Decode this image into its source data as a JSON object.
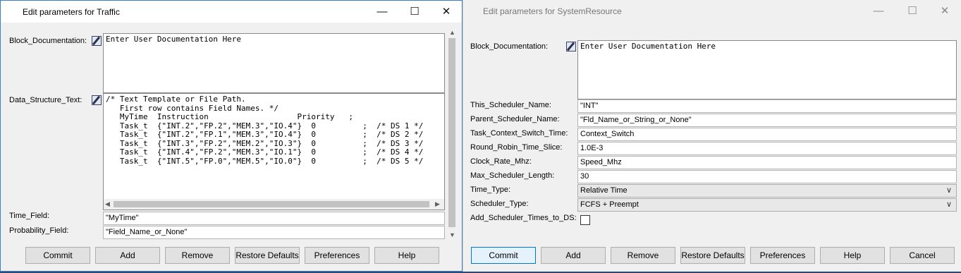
{
  "traffic": {
    "title": "Edit parameters for Traffic",
    "labels": {
      "block_doc": "Block_Documentation:",
      "data_struct": "Data_Structure_Text:",
      "time_field": "Time_Field:",
      "prob_field": "Probability_Field:"
    },
    "block_doc_text": "Enter User Documentation Here",
    "data_struct_text": "/* Text Template or File Path.\n   First row contains Field Names. */\n   MyTime  Instruction                   Priority   ;\n   Task_t  {\"INT.2\",\"FP.2\",\"MEM.3\",\"IO.4\"}  0          ;  /* DS 1 */\n   Task_t  {\"INT.2\",\"FP.1\",\"MEM.3\",\"IO.4\"}  0          ;  /* DS 2 */\n   Task_t  {\"INT.3\",\"FP.2\",\"MEM.2\",\"IO.3\"}  0          ;  /* DS 3 */\n   Task_t  {\"INT.4\",\"FP.2\",\"MEM.3\",\"IO.1\"}  0          ;  /* DS 4 */\n   Task_t  {\"INT.5\",\"FP.0\",\"MEM.5\",\"IO.0\"}  0          ;  /* DS 5 */",
    "time_field_value": "\"MyTime\"",
    "prob_field_value": "\"Field_Name_or_None\"",
    "buttons": {
      "commit": "Commit",
      "add": "Add",
      "remove": "Remove",
      "restore": "Restore Defaults",
      "preferences": "Preferences",
      "help": "Help"
    }
  },
  "sysres": {
    "title": "Edit parameters for SystemResource",
    "labels": {
      "block_doc": "Block_Documentation:",
      "this_sched": "This_Scheduler_Name:",
      "parent_sched": "Parent_Scheduler_Name:",
      "ctx_switch": "Task_Context_Switch_Time:",
      "rr_slice": "Round_Robin_Time_Slice:",
      "clock": "Clock_Rate_Mhz:",
      "max_len": "Max_Scheduler_Length:",
      "time_type": "Time_Type:",
      "sched_type": "Scheduler_Type:",
      "add_times": "Add_Scheduler_Times_to_DS:"
    },
    "block_doc_text": "Enter User Documentation Here",
    "values": {
      "this_sched": "\"INT\"",
      "parent_sched": "\"Fld_Name_or_String_or_None\"",
      "ctx_switch": "Context_Switch",
      "rr_slice": "1.0E-3",
      "clock": "Speed_Mhz",
      "max_len": "30",
      "time_type": "Relative Time",
      "sched_type": "FCFS + Preempt"
    },
    "add_times_checked": false,
    "buttons": {
      "commit": "Commit",
      "add": "Add",
      "remove": "Remove",
      "restore": "Restore Defaults",
      "preferences": "Preferences",
      "help": "Help",
      "cancel": "Cancel"
    }
  },
  "icons": {
    "minimize": "minimize-icon",
    "maximize": "maximize-icon",
    "close": "close-icon",
    "edit": "edit-pencil-icon",
    "chevron": "chevron-down-icon"
  },
  "colors": {
    "active_border": "#3c7fc4",
    "primary_button_border": "#0078d7"
  }
}
